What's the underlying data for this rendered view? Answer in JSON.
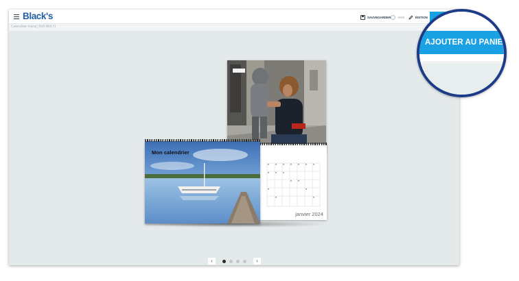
{
  "header": {
    "logo": "Black's",
    "tools": {
      "save_label": "SAUVEGARDER",
      "help_label": "AIDE",
      "edit_label": "ÉDITION"
    }
  },
  "subtitle": "Calendrier mural | 8x6 MULTI",
  "preview": {
    "calendar_title": "Mon calendrier",
    "calendar_month": "janvier 2024"
  },
  "pager": {
    "prev_icon": "chevron-left-icon",
    "next_icon": "chevron-right-icon",
    "pages": 4,
    "current_page": 1
  },
  "magnifier": {
    "add_to_cart_label": "AJOUTER AU PANIER"
  },
  "colors": {
    "brand": "#1f5ea8",
    "accent": "#1aa1e3",
    "magnifier_ring": "#1d3c88",
    "canvas": "#e4e9ea"
  }
}
